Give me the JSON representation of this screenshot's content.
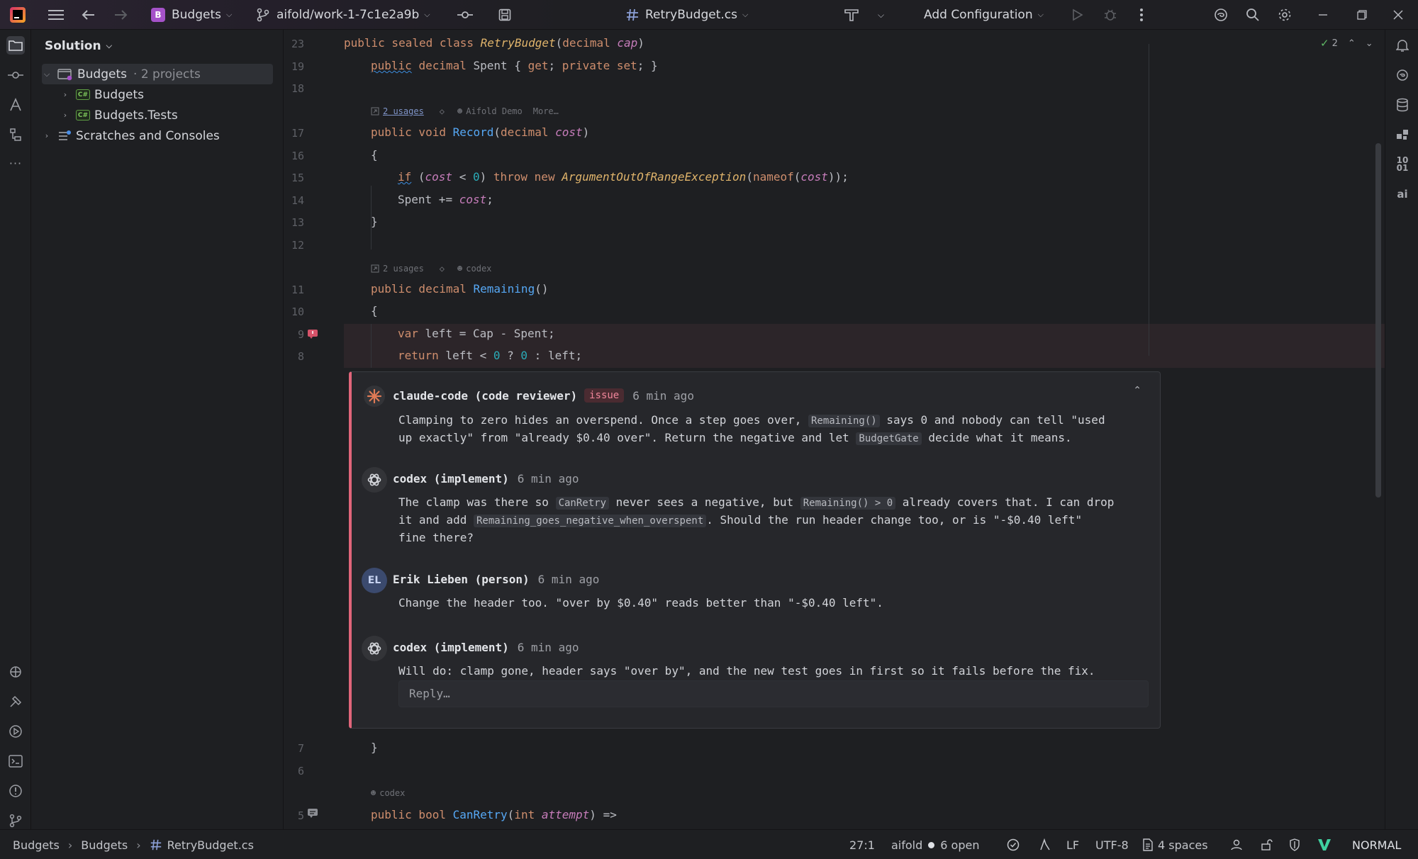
{
  "titlebar": {
    "project_initial": "B",
    "project_name": "Budgets",
    "branch": "aifold/work-1-7c1e2a9b",
    "file_tab": "RetryBudget.cs",
    "run_config": "Add Configuration"
  },
  "project_panel": {
    "title": "Solution",
    "items": [
      {
        "label": "Budgets",
        "suffix": "· 2 projects"
      },
      {
        "label": "Budgets"
      },
      {
        "label": "Budgets.Tests"
      },
      {
        "label": "Scratches and Consoles"
      }
    ],
    "cs_badge": "C#"
  },
  "editor": {
    "inspection_count": "2",
    "lines": {
      "l23": "23",
      "l19": "19",
      "l18": "18",
      "l17": "17",
      "l16": "16",
      "l15": "15",
      "l14": "14",
      "l13": "13",
      "l12": "12",
      "l11": "11",
      "l10": "10",
      "l9": "9",
      "l8": "8",
      "l7": "7",
      "l6": "6",
      "l5": "5"
    },
    "hints": {
      "h1_usages": "2 usages",
      "h1_author": "Aifold Demo",
      "h1_more": "More…",
      "h2_usages": "2 usages",
      "h2_author": "codex",
      "h3_author": "codex"
    }
  },
  "review": {
    "comments": [
      {
        "author": "claude-code (code reviewer)",
        "tag": "issue",
        "time": "6 min ago",
        "t1": "Clamping to zero hides an overspend. Once a step goes over, ",
        "c1": "Remaining()",
        "t2": " says 0 and nobody can tell \"used",
        "t3": "up exactly\" from \"already $0.40 over\". Return the negative and let ",
        "c2": "BudgetGate",
        "t4": " decide what it means."
      },
      {
        "author": "codex (implement)",
        "time": "6 min ago",
        "t1": "The clamp was there so ",
        "c1": "CanRetry",
        "t2": " never sees a negative, but ",
        "c2": "Remaining() > 0",
        "t3": " already covers that. I can drop",
        "t4": "it and add ",
        "c3": "Remaining_goes_negative_when_overspent",
        "t5": ". Should the run header change too, or is \"-$0.40 left\"",
        "t6": "fine there?"
      },
      {
        "author": "Erik Lieben (person)",
        "initials": "EL",
        "time": "6 min ago",
        "t1": "Change the header too. \"over by $0.40\" reads better than \"-$0.40 left\"."
      },
      {
        "author": "codex (implement)",
        "time": "6 min ago",
        "t1": "Will do: clamp gone, header says \"over by\", and the new test goes in first so it fails before the fix."
      }
    ],
    "reply_placeholder": "Reply…"
  },
  "statusbar": {
    "crumbs": [
      "Budgets",
      "Budgets",
      "RetryBudget.cs"
    ],
    "position": "27:1",
    "vcs": "aifold",
    "open": "6 open",
    "line_sep": "LF",
    "encoding": "UTF-8",
    "indent": "4 spaces",
    "mode": "NORMAL"
  },
  "colors": {
    "accent_issue": "#e0657a",
    "ok_green": "#5fb865",
    "vim_badge": "#3fd1a0"
  }
}
